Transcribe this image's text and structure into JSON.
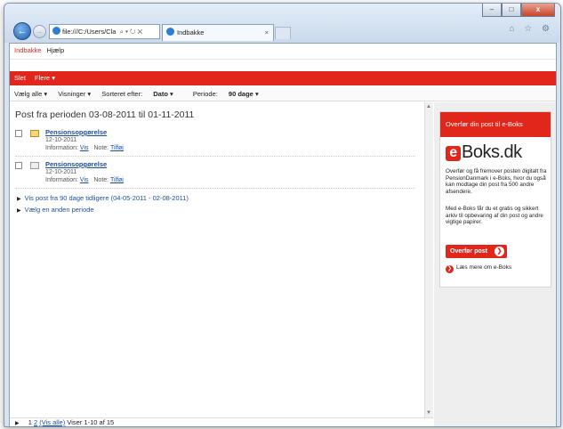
{
  "browser": {
    "address": "file:///C:/Users/Cla",
    "address_controls": "⌕ ▾ ↻ ✕",
    "tab_title": "Indbakke",
    "tab_close": "×",
    "toolbar_icons": "⌂ ☆ ⚙",
    "minimize": "–",
    "maximize": "□",
    "close": "x"
  },
  "topnav": {
    "inbox": "Indbakke",
    "help": "Hjælp"
  },
  "actions": {
    "delete": "Slet",
    "more": "Flere ▾"
  },
  "filters": {
    "select_all": "Vælg alle ▾",
    "views": "Visninger ▾",
    "sort_label": "Sorteret efter:",
    "sort_value": "Dato",
    "sort_arrow": "▾",
    "period_label": "Periode:",
    "period_value": "90 dage",
    "period_arrow": "▾"
  },
  "main": {
    "heading": "Post fra perioden 03-08-2011 til 01-11-2011",
    "items": [
      {
        "title": "Pensionsopgørelse",
        "date": "12-10-2011",
        "info_label": "Information:",
        "info_link": "Vis",
        "note_label": "Note:",
        "note_link": "Tilføj"
      },
      {
        "title": "Pensionsopgørelse",
        "date": "12-10-2011",
        "info_label": "Information:",
        "info_link": "Vis",
        "note_label": "Note:",
        "note_link": "Tilføj"
      }
    ],
    "more_links": [
      "Vis post fra 90 dage tidligere (04-05-2011 - 02-08-2011)",
      "Vælg en anden periode"
    ]
  },
  "pager": {
    "arrow": "▶",
    "page1": "1",
    "page2": "2",
    "show_all": "(Vis alle)",
    "summary": "Viser 1-10 af 15"
  },
  "promo": {
    "header": "Overfør din post til e-Boks",
    "logo_e": "e",
    "logo_text": "Boks.dk",
    "text1": "Overfør og få fremover posten digitalt fra PensionDanmark i e-Boks, hvor du også kan modtage din post fra 500 andre afsendere.",
    "text2": "Med e-Boks får du et gratis og sikkert arkiv til opbevaring af din post og andre vigtige papirer.",
    "cta": "Overfør post",
    "readmore": "Læs mere om e-Boks"
  },
  "colors": {
    "brand_red": "#e1261c",
    "link_blue": "#1a4f9c"
  }
}
